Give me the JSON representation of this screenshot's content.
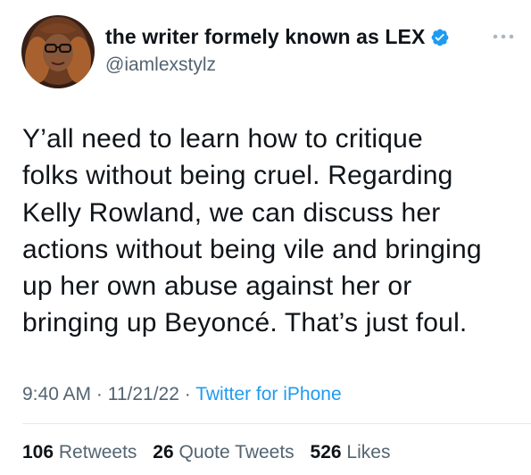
{
  "author": {
    "display_name": "the writer formely known as LEX",
    "handle": "@iamlexstylz",
    "verified_icon": "verified-badge",
    "verified_color": "#1d9bf0"
  },
  "tweet": {
    "lines": [
      "Y’all need to learn how to critique",
      "folks without being cruel. Regarding",
      "Kelly Rowland, we can discuss her",
      "actions without being vile and bringing",
      "up her own abuse against her or",
      "bringing up Beyoncé. That’s just foul."
    ]
  },
  "meta": {
    "time": "9:40 AM",
    "separator": " · ",
    "date": "11/21/22",
    "source": "Twitter for iPhone"
  },
  "stats": {
    "retweets_count": "106",
    "retweets_label": "Retweets",
    "quote_tweets_count": "26",
    "quote_tweets_label": "Quote Tweets",
    "likes_count": "526",
    "likes_label": "Likes"
  },
  "colors": {
    "text": "#0f1419",
    "secondary": "#536471",
    "link": "#1d9bf0"
  }
}
